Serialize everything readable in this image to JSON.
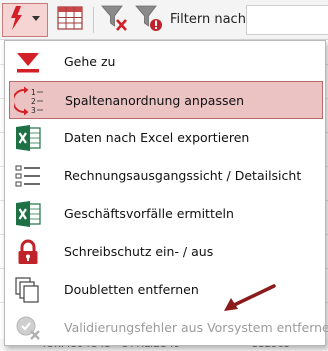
{
  "toolbar": {
    "filter_label": "Filtern nach:",
    "filter_value": "",
    "icons": [
      "lightning-icon",
      "grid-icon",
      "funnel-clear-icon",
      "funnel-warning-icon"
    ]
  },
  "menu": {
    "items": [
      {
        "label": "Gehe zu",
        "icon": "goto-arrow-icon",
        "highlighted": false,
        "enabled": true
      },
      {
        "label": "Spaltenanordnung anpassen",
        "icon": "column-order-icon",
        "highlighted": true,
        "enabled": true
      },
      {
        "label": "Daten nach Excel exportieren",
        "icon": "excel-icon",
        "highlighted": false,
        "enabled": true
      },
      {
        "label": "Rechnungsausgangssicht / Detailsicht",
        "icon": "list-view-icon",
        "highlighted": false,
        "enabled": true
      },
      {
        "label": "Geschäftsvorfälle ermitteln",
        "icon": "excel-icon",
        "highlighted": false,
        "enabled": true
      },
      {
        "label": "Schreibschutz ein- / aus",
        "icon": "lock-icon",
        "highlighted": false,
        "enabled": true
      },
      {
        "label": "Doubletten entfernen",
        "icon": "duplicates-icon",
        "highlighted": false,
        "enabled": true
      },
      {
        "label": "Validierungsfehler aus Vorsystem entfernen",
        "icon": "validation-remove-icon",
        "highlighted": false,
        "enabled": false
      }
    ]
  },
  "background": {
    "bottom_row_text": "4UK.4394U43 · UTTILIEU49",
    "bottom_row_number": "332963"
  },
  "colors": {
    "accent_red": "#d31f26",
    "highlight_bg": "#ecc3c3",
    "highlight_border": "#b96a6a",
    "excel_green": "#1e7145",
    "annotation_arrow": "#8b1a1a"
  }
}
